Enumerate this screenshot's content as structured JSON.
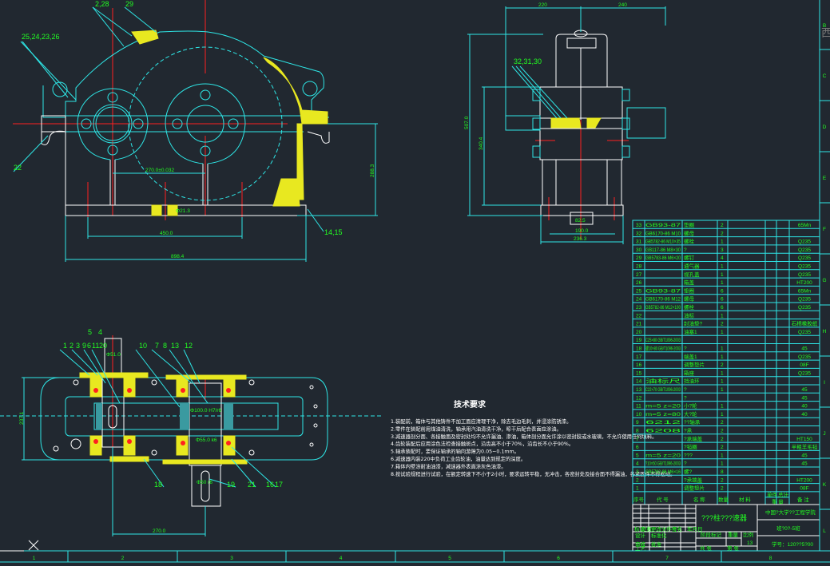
{
  "colors": {
    "background": "#212830",
    "outline": "#2ee6e6",
    "text": "#22ff22",
    "centerline": "#ff2020",
    "section": "#e8e820",
    "edge": "#ffffff"
  },
  "front_view": {
    "balloons": [
      "2,28",
      "29",
      "25,24,23,26",
      "22",
      "14,15"
    ],
    "dims": {
      "center_distance": "270.0±0.032",
      "feet": "450.0",
      "overall_length": "898.4",
      "height": "288.3",
      "hole": "Φ21.3"
    }
  },
  "side_view": {
    "balloons": [
      "32,31,30"
    ],
    "dims": {
      "left": "220",
      "right": "240",
      "overall_height": "507.0",
      "axis_height": "340.4",
      "feet": "190.0",
      "base": "236.3",
      "slot": "82.5"
    }
  },
  "top_view": {
    "balloons_top": [
      "1",
      "2",
      "3",
      "9",
      "6",
      "11",
      "20",
      "5",
      "4",
      "10",
      "7",
      "8",
      "13",
      "12"
    ],
    "balloons_bottom": [
      "18",
      "19",
      "21",
      "16",
      "17"
    ],
    "dims": {
      "width": "237.1",
      "center_distance": "270.0",
      "fit1": "Φ100.0 H7/r6",
      "fit2": "Φ55.0 k6",
      "fit3": "Φ50 r6",
      "fit4": "Φ51.0"
    }
  },
  "tech_requirements": {
    "title": "技术要求",
    "lines": [
      "1.装配前，箱体与其他铸件不加工面应清理干净，除去毛边毛刺，并浸涂防锈漆。",
      "2.零件在装配前用煤油清洗，轴承用汽油清洗干净，晾干后配合表面应涂油。",
      "3.减速器剖分面、各接触面及密封处均不允许漏油、渗油，箱体剖分面允许涂以密封胶或水玻璃，不允许使用任何填料。",
      "4.齿轮装配后应用涂色法检查接触斑点，沿齿高不小于70%，沿齿长不小于90%。",
      "5.轴承装配时，要保证轴承的轴向游隙为0.05~0.1mm。",
      "6.减速器内装220中负荷工业齿轮油，油量达到规定的深度。",
      "7.箱体内壁涂耐油油漆，减速器外表面涂灰色油漆。",
      "8.按试验规程进行试验，在额定转速下不小于2小时，要求运转平稳，无冲击，各密封处及接合面不得漏油，各紧固件不得松动。"
    ]
  },
  "parts_list": {
    "headers": {
      "seq": "序号",
      "code": "代 号",
      "name": "名 称",
      "qty": "数量",
      "material": "材 料",
      "single": "单件",
      "total": "总计",
      "weight": "重 量",
      "remark": "备 注"
    },
    "rows": [
      {
        "seq": "33",
        "code": "GB93-87",
        "name": "垫圈",
        "qty": "2",
        "remark": "65Mn"
      },
      {
        "seq": "32",
        "code": "GB6170-86 M10",
        "name": "螺母",
        "qty": "2",
        "remark": ""
      },
      {
        "seq": "31",
        "code": "GB5782-86 M10×35",
        "name": "螺栓",
        "qty": "1",
        "remark": "Q235"
      },
      {
        "seq": "30",
        "code": "GB117-86 M8×30",
        "name": "?",
        "qty": "3",
        "remark": "Q235"
      },
      {
        "seq": "29",
        "code": "GB5783-86 M6×20",
        "name": "螺钉",
        "qty": "4",
        "remark": "Q235"
      },
      {
        "seq": "28",
        "code": "",
        "name": "通气器",
        "qty": "1",
        "remark": "Q235"
      },
      {
        "seq": "27",
        "code": "",
        "name": "视孔盖",
        "qty": "1",
        "remark": "Q235"
      },
      {
        "seq": "26",
        "code": "",
        "name": "箱盖",
        "qty": "1",
        "remark": "HT200"
      },
      {
        "seq": "25",
        "code": "GB93-87",
        "name": "垫圈",
        "qty": "6",
        "remark": "65Mn"
      },
      {
        "seq": "24",
        "code": "GB6170-86 M12",
        "name": "螺母",
        "qty": "6",
        "remark": "Q235"
      },
      {
        "seq": "23",
        "code": "GB5782-86 M12×100",
        "name": "螺栓",
        "qty": "6",
        "remark": "Q235"
      },
      {
        "seq": "22",
        "code": "",
        "name": "油标",
        "qty": "1",
        "remark": ""
      },
      {
        "seq": "21",
        "code": "",
        "name": "封油垫?",
        "qty": "2",
        "remark": "石棉橡胶纸"
      },
      {
        "seq": "20",
        "code": "",
        "name": "油塞1",
        "qty": "1",
        "remark": "Q235"
      },
      {
        "seq": "19",
        "code": "C25×80 GB/T1096-2003",
        "name": "",
        "qty": "",
        "remark": ""
      },
      {
        "seq": "18",
        "code": "键10×80 GB/T1096-2003",
        "name": "?",
        "qty": "1",
        "remark": "45"
      },
      {
        "seq": "17",
        "code": "",
        "name": "端盖1",
        "qty": "1",
        "remark": "Q235"
      },
      {
        "seq": "16",
        "code": "",
        "name": "调整垫片",
        "qty": "2",
        "remark": "08F"
      },
      {
        "seq": "15",
        "code": "",
        "name": "箱座",
        "qty": "1",
        "remark": "Q235"
      },
      {
        "seq": "14",
        "code": "油标尺",
        "name": "挡油环",
        "qty": "1",
        "remark": ""
      },
      {
        "seq": "13",
        "code": "C22×70 GB/T1096-2003",
        "name": "?",
        "qty": "1",
        "remark": "45"
      },
      {
        "seq": "12",
        "code": "",
        "name": "?",
        "qty": "",
        "remark": "45"
      },
      {
        "seq": "11",
        "code": "m=5 z=20",
        "name": "小?轮",
        "qty": "1",
        "remark": "40"
      },
      {
        "seq": "10",
        "code": "m=5 z=80",
        "name": "大?轮",
        "qty": "1",
        "remark": "40"
      },
      {
        "seq": "9",
        "code": "6212",
        "name": "??轴承",
        "qty": "2",
        "remark": ""
      },
      {
        "seq": "8",
        "code": "6208",
        "name": "?承",
        "qty": "2",
        "remark": ""
      },
      {
        "seq": "7",
        "code": "",
        "name": "?承端盖",
        "qty": "2",
        "remark": "HT150"
      },
      {
        "seq": "6",
        "code": "",
        "name": "?毡圈",
        "qty": "2",
        "remark": "半粗羊毛毡"
      },
      {
        "seq": "5",
        "code": "m=5 z=20",
        "name": "???",
        "qty": "1",
        "remark": "45"
      },
      {
        "seq": "4",
        "code": "?10×50 GB/T1096-2003",
        "name": "?",
        "qty": "1",
        "remark": "45"
      },
      {
        "seq": "3",
        "code": "GB5782-86 M6×16",
        "name": "螺?",
        "qty": "8",
        "remark": ""
      },
      {
        "seq": "2",
        "code": "",
        "name": "?承端盖",
        "qty": "2",
        "remark": "HT200"
      },
      {
        "seq": "1",
        "code": "",
        "name": "调整垫片",
        "qty": "2",
        "remark": "08F"
      }
    ]
  },
  "title_block": {
    "drawing_title": "???柱???速器",
    "school": "中国?大学??工程学院",
    "class": "班?0?-5班",
    "student_id": "学号：120??5?00",
    "sheet_count": "13",
    "labels": [
      "标记",
      "处数",
      "分区",
      "更改文件号",
      "签名",
      "年月日",
      "设计",
      "标准化",
      "审核",
      "工艺",
      "批准",
      "阶段标记",
      "重量",
      "比例",
      "共 张",
      "第 张"
    ]
  },
  "grid": {
    "columns": [
      "1",
      "2",
      "3",
      "4",
      "5",
      "6",
      "7",
      "8"
    ],
    "rows": [
      "B",
      "C",
      "D",
      "E",
      "F",
      "G",
      "H",
      "I",
      "J",
      "K",
      "L"
    ]
  }
}
